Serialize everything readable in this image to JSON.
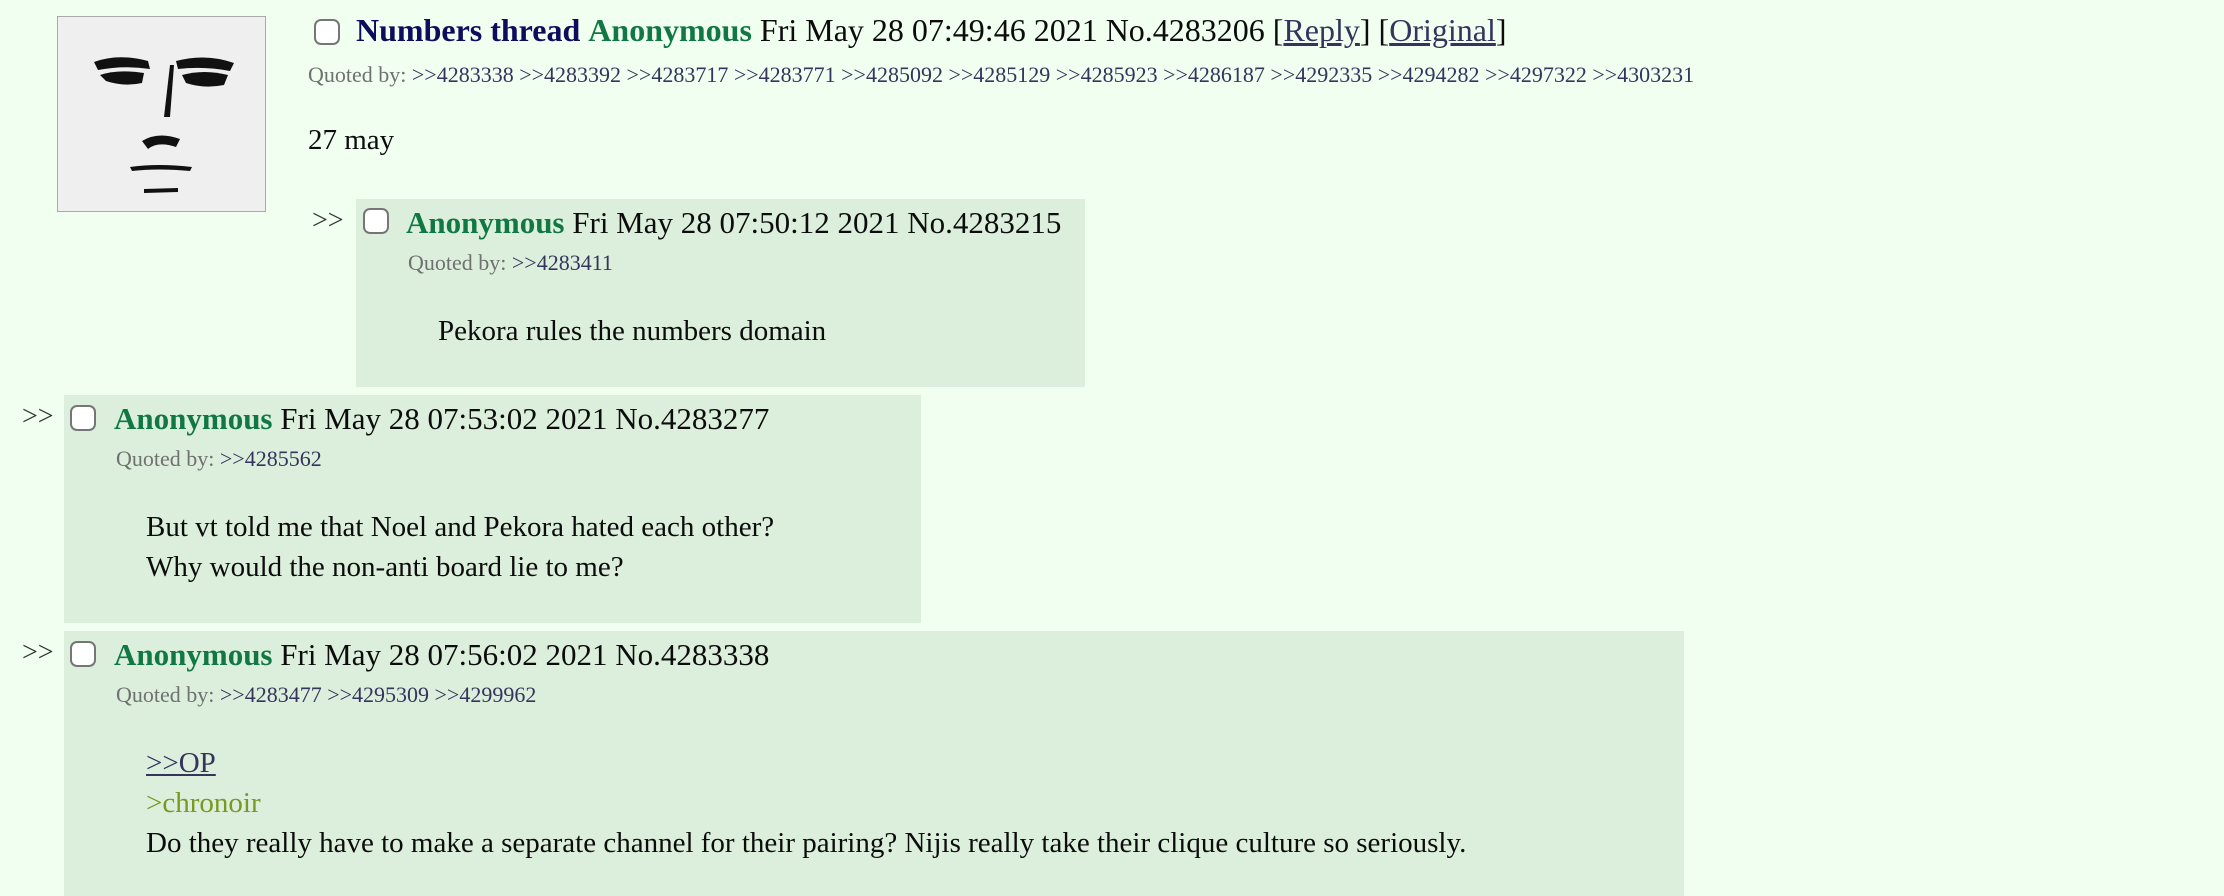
{
  "op": {
    "subject": "Numbers thread",
    "name": "Anonymous",
    "datetime": "Fri May 28 07:49:46 2021",
    "number": "No.4283206",
    "reply_link": "Reply",
    "original_link": "Original",
    "quoted_by_label": "Quoted by:",
    "quoted_by": ">>4283338 >>4283392 >>4283717 >>4283771 >>4285092 >>4285129 >>4285923 >>4286187 >>4292335 >>4294282 >>4297322 >>4303231",
    "body": "27 may"
  },
  "replies": [
    {
      "arrows": ">>",
      "name": "Anonymous",
      "datetime": "Fri May 28 07:50:12 2021",
      "number": "No.4283215",
      "quoted_by_label": "Quoted by:",
      "quoted_by": ">>4283411",
      "body_line1": "Pekora rules the numbers domain"
    },
    {
      "arrows": ">>",
      "name": "Anonymous",
      "datetime": "Fri May 28 07:53:02 2021",
      "number": "No.4283277",
      "quoted_by_label": "Quoted by:",
      "quoted_by": ">>4285562",
      "body_line1": "But vt told me that Noel and Pekora hated each other?",
      "body_line2": "Why would the non-anti board lie to me?"
    },
    {
      "arrows": ">>",
      "name": "Anonymous",
      "datetime": "Fri May 28 07:56:02 2021",
      "number": "No.4283338",
      "quoted_by_label": "Quoted by:",
      "quoted_by": ">>4283477 >>4295309 >>4299962",
      "body_link": ">>OP",
      "body_greentext": ">chronoir",
      "body_line": "Do they really have to make a separate channel for their pairing? Nijis really take their clique culture so seriously."
    }
  ]
}
